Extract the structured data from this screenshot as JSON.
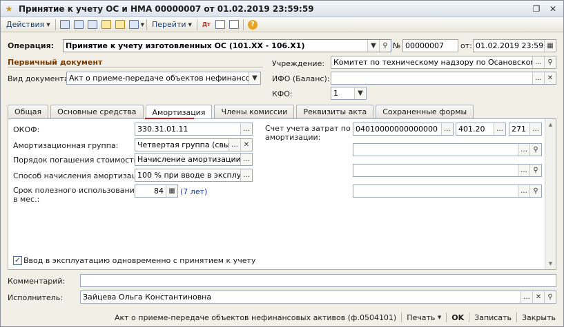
{
  "window": {
    "title": "Принятие к учету ОС и НМА 00000007 от 01.02.2019 23:59:59"
  },
  "toolbar": {
    "actions_label": "Действия",
    "goto_label": "Перейти"
  },
  "header": {
    "operation_label": "Операция:",
    "operation_value": "Принятие к учету изготовленных ОС (101.ХХ - 106.Х1)",
    "number_label": "№",
    "number_value": "00000007",
    "date_label": "от:",
    "date_value": "01.02.2019 23:59:59"
  },
  "primary_doc": {
    "section_title": "Первичный документ",
    "doc_type_label": "Вид документа:",
    "doc_type_value": "Акт о приеме-передаче объектов нефинансовых ак",
    "institution_label": "Учреждение:",
    "institution_value": "Комитет по техническому надзору по Осановскому райо",
    "ifo_label": "ИФО (Баланс):",
    "ifo_value": "",
    "kfo_label": "КФО:",
    "kfo_value": "1"
  },
  "tabs": [
    {
      "label": "Общая"
    },
    {
      "label": "Основные средства"
    },
    {
      "label": "Амортизация"
    },
    {
      "label": "Члены комиссии"
    },
    {
      "label": "Реквизиты акта"
    },
    {
      "label": "Сохраненные формы"
    }
  ],
  "amort": {
    "okof_label": "ОКОФ:",
    "okof_value": "330.31.01.11",
    "group_label": "Амортизационная группа:",
    "group_value": "Четвертая группа (свыше",
    "repay_label": "Порядок погашения стоимости:",
    "repay_value": "Начисление амортизации",
    "method_label": "Способ начисления амортизации:",
    "method_value": "100 % при вводе в эксплуата",
    "term_label_1": "Срок полезного использования,",
    "term_label_2": "в мес.:",
    "term_value": "84",
    "term_years": "(7 лет)",
    "account_label_1": "Счет учета затрат по",
    "account_label_2": "амортизации:",
    "account_value": "04010000000000000",
    "account_sub1": "401.20",
    "account_sub2": "271",
    "checkbox_label": "Ввод в эксплуатацию одновременно с принятием к учету"
  },
  "footer": {
    "comment_label": "Комментарий:",
    "comment_value": "",
    "executor_label": "Исполнитель:",
    "executor_value": "Зайцева Ольга Константиновна"
  },
  "bottom": {
    "print_form": "Акт о приеме-передаче объектов нефинансовых активов (ф.0504101)",
    "print_label": "Печать",
    "ok_label": "OK",
    "save_label": "Записать",
    "close_label": "Закрыть"
  }
}
